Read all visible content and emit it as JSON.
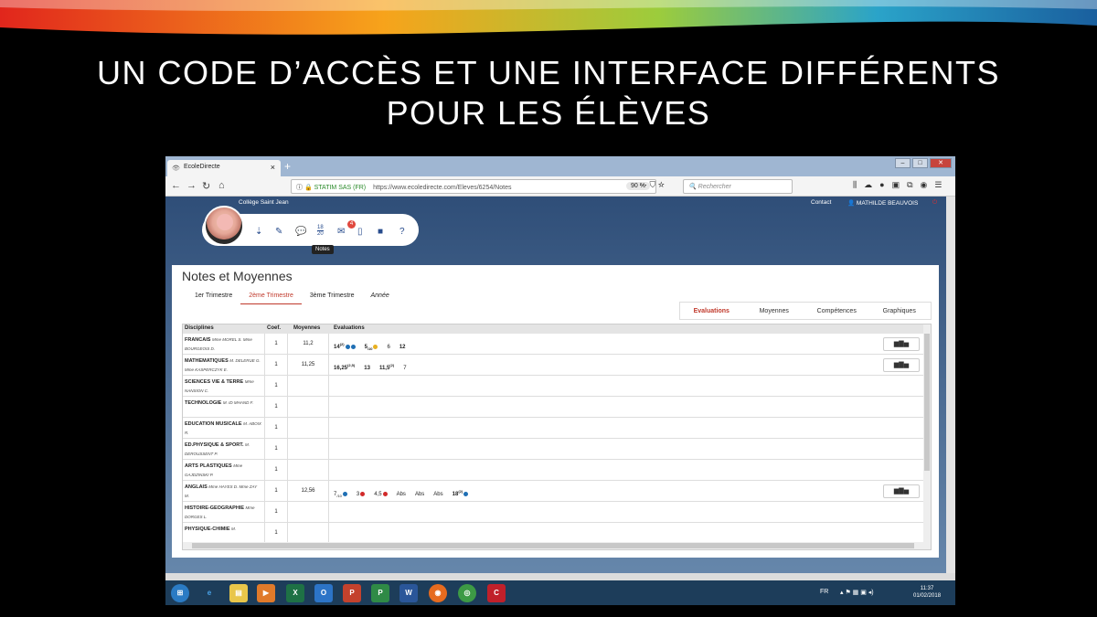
{
  "slide": {
    "title_line1": "UN CODE D’ACCÈS ET UNE INTERFACE DIFFÉRENTS",
    "title_line2": "POUR LES ÉLÈVES"
  },
  "browser": {
    "tab_title": "EcoleDirecte",
    "tab_close": "×",
    "new_tab": "+",
    "address_org": "STATIM SAS (FR)",
    "address_url": "https://www.ecoledirecte.com/Eleves/6254/Notes",
    "zoom": "90 %",
    "search_placeholder": "Rechercher"
  },
  "site": {
    "school": "Collège Saint Jean",
    "contact": "Contact",
    "user": "MATHILDE BEAUVOIS",
    "notes_icon_top": "18",
    "notes_icon_bottom": "20",
    "messages_badge": "4",
    "tooltip": "Notes"
  },
  "card": {
    "title": "Notes et Moyennes",
    "periods": [
      "1er Trimestre",
      "2ème Trimestre",
      "3ème Trimestre",
      "Année"
    ],
    "view_tabs": [
      "Evaluations",
      "Moyennes",
      "Compétences",
      "Graphiques"
    ],
    "headers": [
      "Disciplines",
      "Coef.",
      "Moyennes",
      "Evaluations"
    ],
    "rows": [
      {
        "subject": "FRANCAIS",
        "prof": "Mme MOREL S.  Mme BOURGEOIS D.",
        "coef": "1",
        "avg": "11,2",
        "notes": [
          {
            "v": "14",
            "sup": "(2)",
            "dots": [
              "#1f6fb4",
              "#1f6fb4"
            ]
          },
          {
            "v": "5",
            "sub": "/10",
            "dots": [
              "#e8b020"
            ]
          },
          {
            "v": "6",
            "plain": true
          },
          {
            "v": "12"
          }
        ]
      },
      {
        "subject": "MATHEMATIQUES",
        "prof": "M. DELERUE G.  Mme KASPERCZYK E.",
        "coef": "1",
        "avg": "11,25",
        "notes": [
          {
            "v": "16,25",
            "sup": "(2,5)"
          },
          {
            "v": "13"
          },
          {
            "v": "11,5",
            "sup": "(2)"
          },
          {
            "v": "7",
            "plain": true
          }
        ]
      },
      {
        "subject": "SCIENCES VIE & TERRE",
        "prof": "Mme NANSION C.",
        "coef": "1",
        "avg": "",
        "notes": []
      },
      {
        "subject": "TECHNOLOGIE",
        "prof": "M. ID MHAND F.",
        "coef": "1",
        "avg": "",
        "notes": []
      },
      {
        "subject": "EDUCATION MUSICALE",
        "prof": "M. ABOIX R.",
        "coef": "1",
        "avg": "",
        "notes": []
      },
      {
        "subject": "ED.PHYSIQUE & SPORT.",
        "prof": "M. DEROUSSENT P.",
        "coef": "1",
        "avg": "",
        "notes": []
      },
      {
        "subject": "ARTS PLASTIQUES",
        "prof": "Mme GAJDZINSKI P.",
        "coef": "1",
        "avg": "",
        "notes": []
      },
      {
        "subject": "ANGLAIS",
        "prof": "Mme HAYES D.  Mme ZAY M.",
        "coef": "1",
        "avg": "12,56",
        "notes": [
          {
            "v": "7",
            "sub": "/10",
            "dots": [
              "#1f6fb4"
            ],
            "plain": true
          },
          {
            "v": "3",
            "dots": [
              "#d12a2a"
            ],
            "plain": true
          },
          {
            "v": "4,5",
            "dots": [
              "#d12a2a"
            ],
            "plain": true
          },
          {
            "v": "Abs",
            "plain": true
          },
          {
            "v": "Abs",
            "plain": true
          },
          {
            "v": "Abs",
            "plain": true
          },
          {
            "v": "18",
            "sup": "(2)",
            "dots": [
              "#1f6fb4"
            ]
          }
        ]
      },
      {
        "subject": "HISTOIRE-GEOGRAPHIE",
        "prof": "Mme DORGES L.",
        "coef": "1",
        "avg": "",
        "notes": []
      },
      {
        "subject": "PHYSIQUE-CHIMIE",
        "prof": "M.",
        "coef": "1",
        "avg": "",
        "notes": []
      }
    ]
  },
  "taskbar": {
    "lang": "FR",
    "time": "11:37",
    "date": "01/02/2018"
  }
}
